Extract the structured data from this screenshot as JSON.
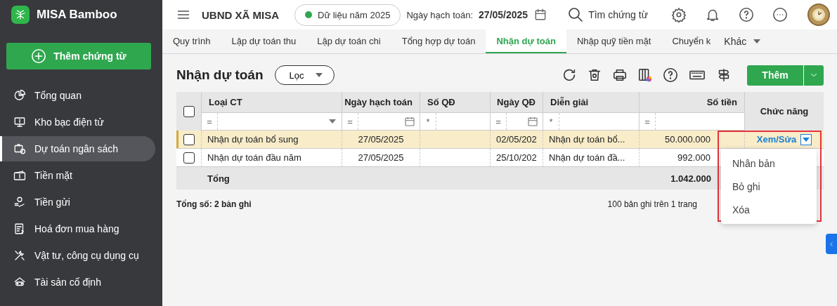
{
  "app": {
    "name": "MISA Bamboo",
    "add_voucher": "Thêm chứng từ"
  },
  "sidebar": {
    "items": [
      {
        "label": "Tổng quan",
        "selected": false
      },
      {
        "label": "Kho bạc điện tử",
        "selected": false
      },
      {
        "label": "Dự toán ngân sách",
        "selected": true
      },
      {
        "label": "Tiền mặt",
        "selected": false
      },
      {
        "label": "Tiền gửi",
        "selected": false
      },
      {
        "label": "Hoá đơn mua hàng",
        "selected": false
      },
      {
        "label": "Vật tư, công cụ dụng cụ",
        "selected": false
      },
      {
        "label": "Tài sản cố định",
        "selected": false
      }
    ]
  },
  "topbar": {
    "org": "UBND XÃ MISA",
    "data_year": "Dữ liệu năm 2025",
    "date_label": "Ngày hạch toán:",
    "date_value": "27/05/2025",
    "search": "Tìm chứng từ"
  },
  "tabs": [
    {
      "label": "Quy trình",
      "selected": false
    },
    {
      "label": "Lập dự toán thu",
      "selected": false
    },
    {
      "label": "Lập dự toán chi",
      "selected": false
    },
    {
      "label": "Tổng hợp dự toán",
      "selected": false
    },
    {
      "label": "Nhận dự toán",
      "selected": true
    },
    {
      "label": "Nhập quỹ tiền mặt",
      "selected": false
    },
    {
      "label": "Chuyển k",
      "selected": false
    }
  ],
  "more_tab": "Khác",
  "page": {
    "title": "Nhận dự toán",
    "filter": "Lọc",
    "add": "Thêm"
  },
  "table": {
    "select_all_checked": false,
    "columns": [
      "Loại CT",
      "Ngày hạch toán",
      "Số QĐ",
      "Ngày QĐ",
      "Diễn giải",
      "Số tiền",
      "Chức năng"
    ],
    "filters": [
      {
        "op": "=",
        "kind": "select"
      },
      {
        "op": "=",
        "kind": "date"
      },
      {
        "op": "*",
        "kind": "text"
      },
      {
        "op": "=",
        "kind": "date"
      },
      {
        "op": "*",
        "kind": "text"
      },
      {
        "op": "=",
        "kind": "text"
      }
    ],
    "rows": [
      {
        "selected": true,
        "checked": false,
        "type": "Nhận dự toán bổ sung",
        "posting_date": "27/05/2025",
        "decision_date": "02/05/202",
        "description": "Nhận dự toán bổ...",
        "amount": "50.000.000",
        "action": "Xem/Sửa"
      },
      {
        "selected": false,
        "checked": false,
        "type": "Nhận dự toán đầu năm",
        "posting_date": "27/05/2025",
        "decision_date": "25/10/202",
        "description": "Nhận dự toán đầ...",
        "amount": "992.000"
      }
    ],
    "total_label": "Tổng",
    "total": "1.042.000"
  },
  "summary": "Tổng số: 2 bản ghi",
  "pagination": "100 bản ghi trên 1 trang",
  "action_menu": {
    "items": [
      "Nhân bản",
      "Bỏ ghi",
      "Xóa"
    ]
  }
}
